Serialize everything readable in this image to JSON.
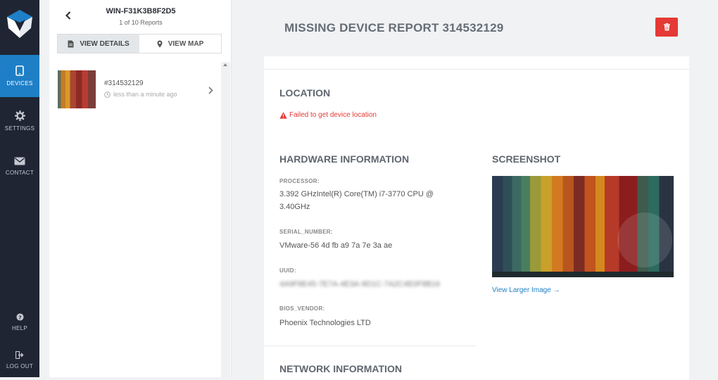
{
  "nav": {
    "items": [
      {
        "label": "DEVICES",
        "icon": "tablet-icon",
        "active": true
      },
      {
        "label": "SETTINGS",
        "icon": "gear-icon"
      },
      {
        "label": "CONTACT",
        "icon": "envelope-icon"
      }
    ],
    "bottom": [
      {
        "label": "HELP",
        "icon": "question-circle-icon"
      },
      {
        "label": "LOG OUT",
        "icon": "logout-icon"
      }
    ]
  },
  "panel": {
    "title": "WIN-F31K3B8F2D5",
    "subtitle": "1 of 10 Reports",
    "tabs": [
      {
        "label": "VIEW DETAILS",
        "icon": "document-icon",
        "active": true
      },
      {
        "label": "VIEW MAP",
        "icon": "map-pin-icon"
      }
    ],
    "reports": [
      {
        "id": "#314532129",
        "time": "less than a minute ago"
      }
    ]
  },
  "main": {
    "title": "MISSING DEVICE REPORT 314532129",
    "location": {
      "heading": "LOCATION",
      "error": "Failed to get device location"
    },
    "hardware": {
      "heading": "HARDWARE INFORMATION",
      "fields": [
        {
          "label": "PROCESSOR:",
          "value": "3.392 GHzIntel(R) Core(TM) i7-3770 CPU @ 3.40GHz"
        },
        {
          "label": "SERIAL_NUMBER:",
          "value": "VMware-56 4d fb a9 7a 7e 3a ae"
        },
        {
          "label": "UUID:",
          "value": "4A9F8E45-7E7A-4E3A-9D1C-7A2C4E0F8B16",
          "blurred": true
        },
        {
          "label": "BIOS_VENDOR:",
          "value": "Phoenix Technologies LTD"
        }
      ]
    },
    "screenshot": {
      "heading": "SCREENSHOT",
      "link": "View Larger Image →"
    },
    "network": {
      "heading": "NETWORK INFORMATION"
    }
  },
  "colors": {
    "accent": "#1e7fc6",
    "danger": "#e53935",
    "rail": "#1f2533"
  }
}
